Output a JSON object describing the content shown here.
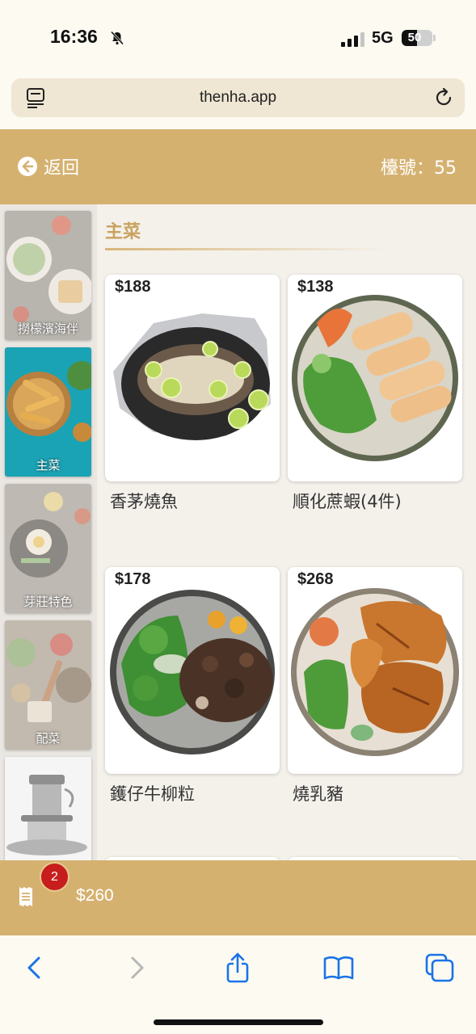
{
  "status": {
    "time": "16:36",
    "network": "5G",
    "battery": "50",
    "battery_level": 0.5
  },
  "browser": {
    "url": "thenha.app"
  },
  "header": {
    "back_label": "返回",
    "table_label": "檯號：55"
  },
  "sidebar": {
    "items": [
      {
        "label": "撈檬濱海伴",
        "active": false
      },
      {
        "label": "主菜",
        "active": true
      },
      {
        "label": "芽莊特色",
        "active": false
      },
      {
        "label": "配菜",
        "active": false
      },
      {
        "label": "",
        "active": false
      }
    ]
  },
  "main": {
    "section_title": "主菜",
    "dishes": [
      {
        "price": "$188",
        "name": "香茅燒魚"
      },
      {
        "price": "$138",
        "name": "順化蔗蝦(4件)"
      },
      {
        "price": "$178",
        "name": "鑊仔牛柳粒"
      },
      {
        "price": "$268",
        "name": "燒乳豬"
      }
    ]
  },
  "cart": {
    "count": "2",
    "total": "$260"
  },
  "colors": {
    "accent": "#d5b170",
    "badge": "#c81d1d",
    "title": "#c9a25e",
    "ios_blue": "#1a73e8"
  }
}
